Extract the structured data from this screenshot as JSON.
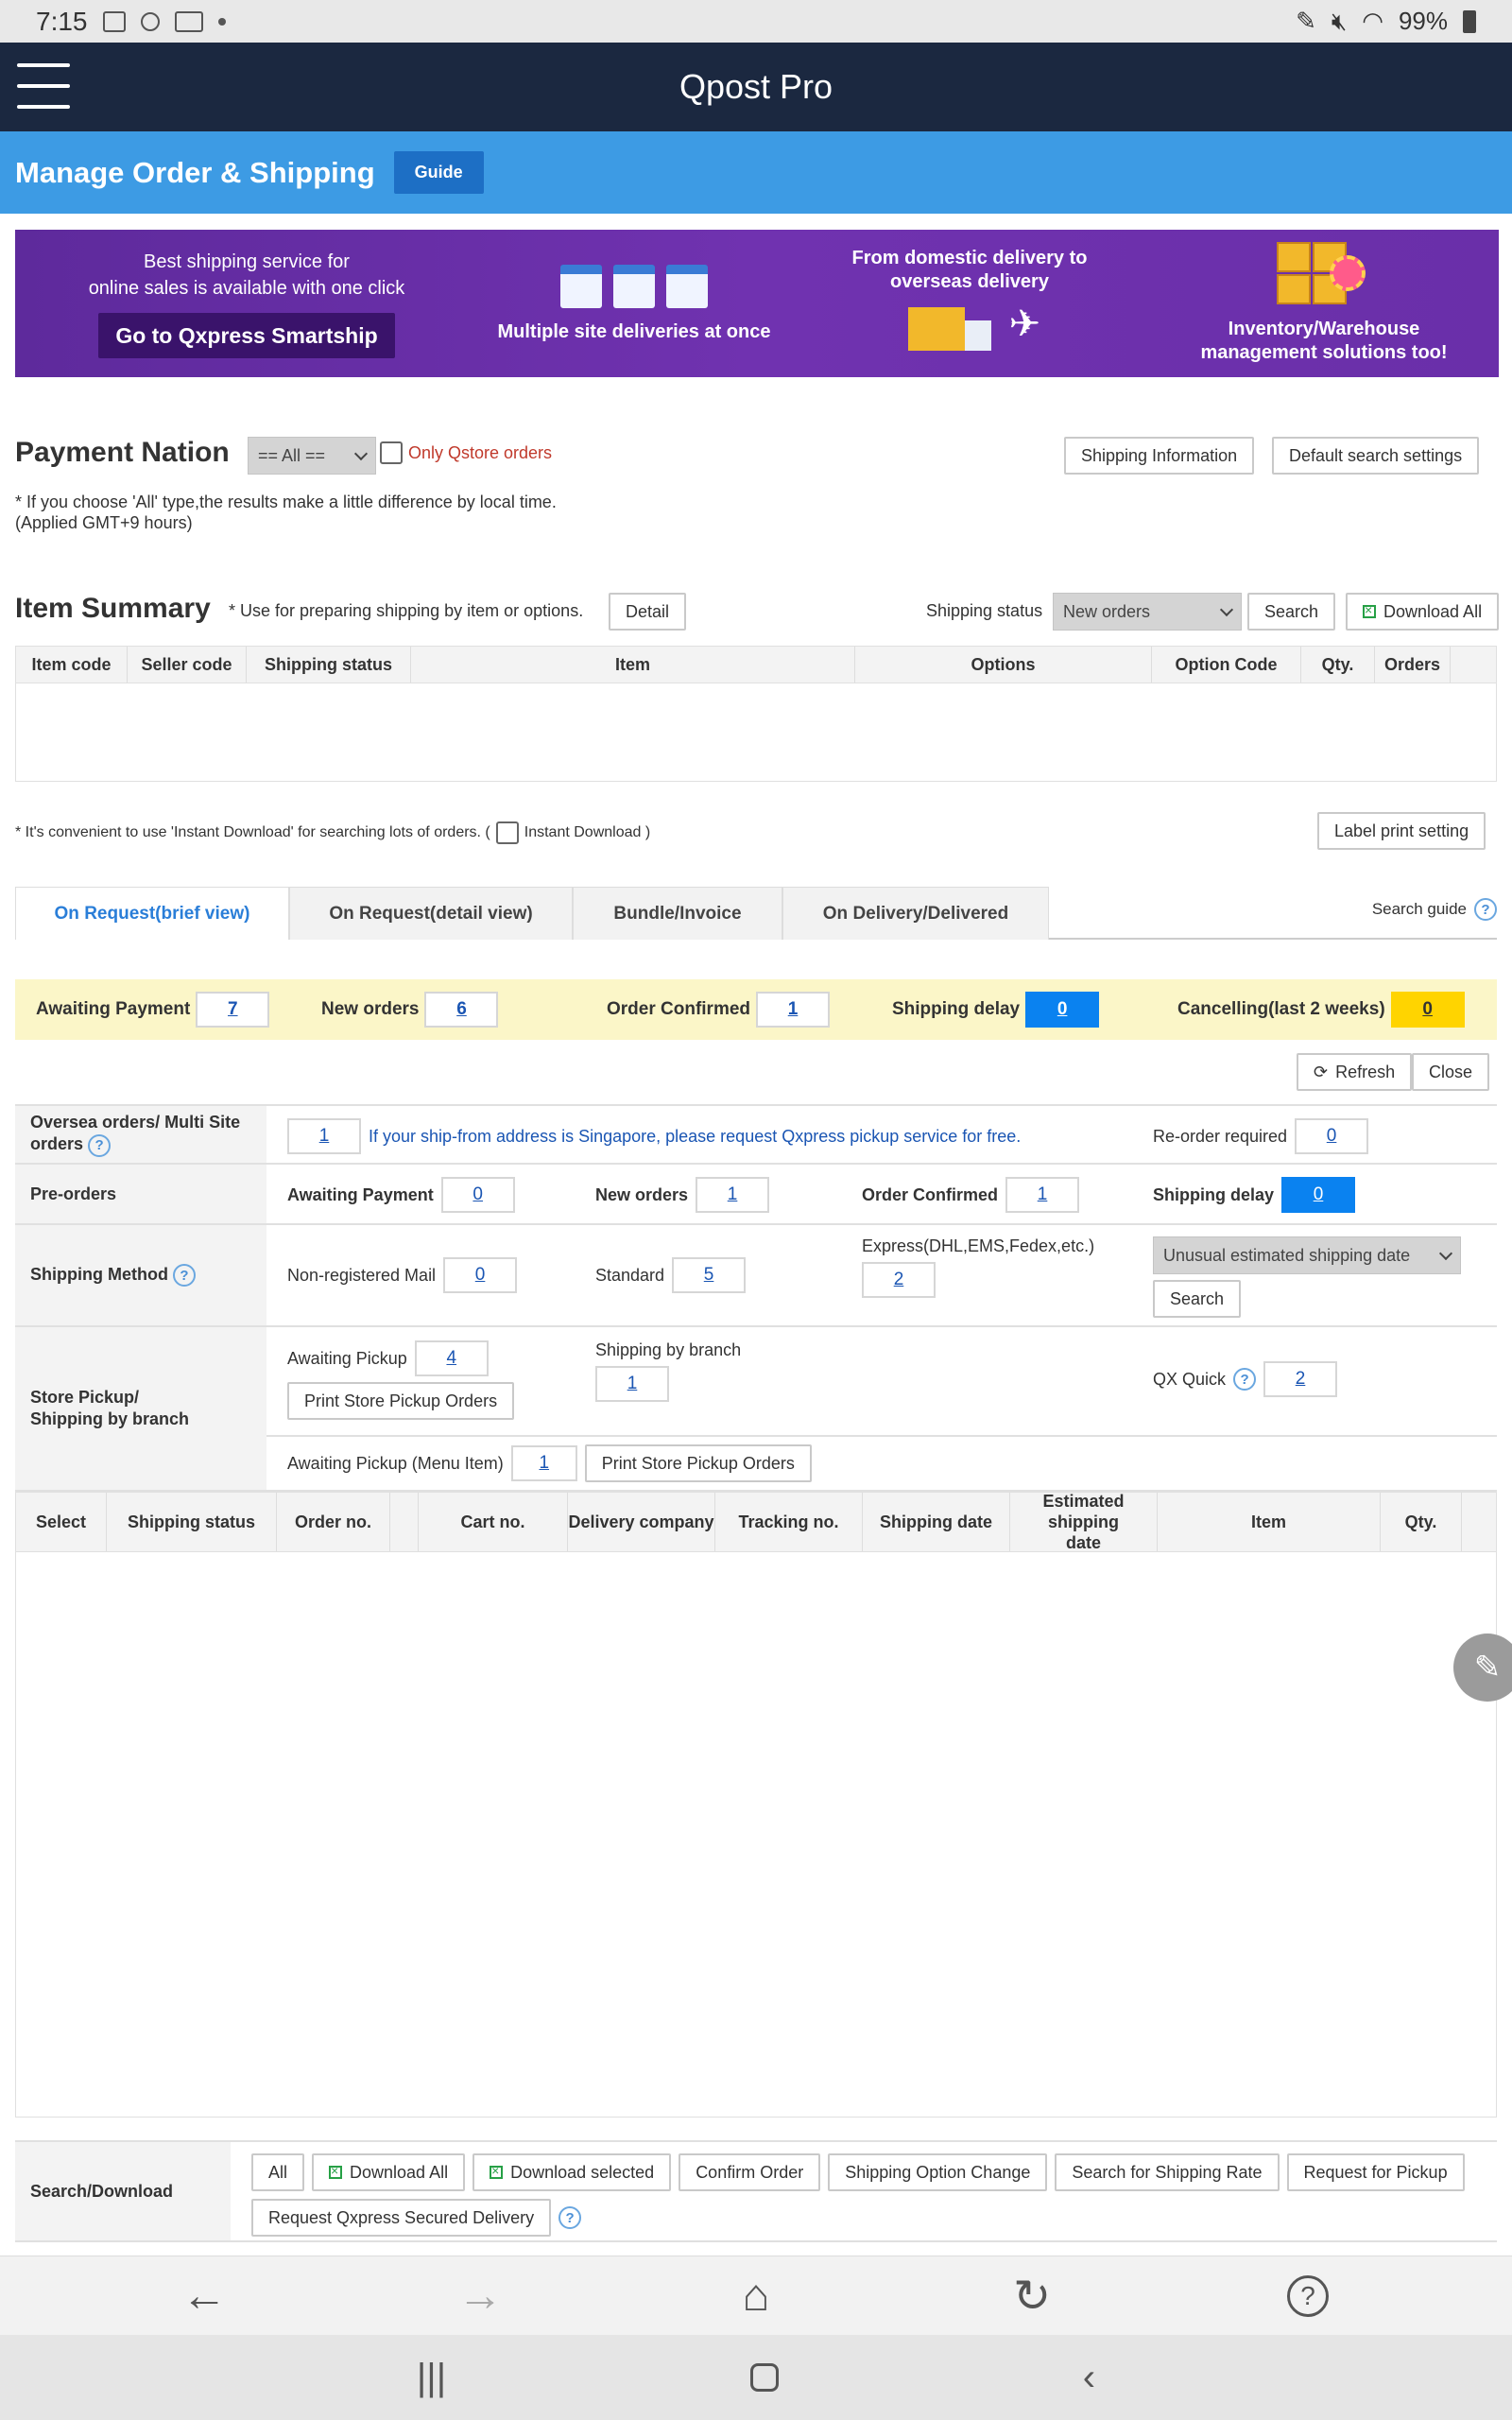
{
  "status_bar": {
    "time": "7:15",
    "battery": "99%"
  },
  "app": {
    "title": "Qpost Pro"
  },
  "page": {
    "title": "Manage Order & Shipping",
    "guide": "Guide"
  },
  "banner": {
    "line1": "Best shipping service for",
    "line2": "online sales is available with one click",
    "cta": "Go to Qxpress Smartship",
    "multi_site": "Multiple site deliveries at once",
    "domestic1": "From domestic delivery to",
    "domestic2": "overseas delivery",
    "inventory1": "Inventory/Warehouse",
    "inventory2": "management solutions too!"
  },
  "payment_nation": {
    "title": "Payment Nation",
    "select_value": "== All ==",
    "qstore_label": "Only Qstore orders",
    "shipping_info_btn": "Shipping Information",
    "default_search_btn": "Default search settings",
    "note1": "* If you choose 'All' type,the results make a little difference by local time.",
    "note2": "(Applied GMT+9 hours)"
  },
  "item_summary": {
    "title": "Item Summary",
    "note": "* Use for preparing shipping by item or options.",
    "detail_btn": "Detail",
    "status_label": "Shipping status",
    "status_value": "New orders",
    "search_btn": "Search",
    "download_all_btn": "Download All",
    "columns": [
      "Item code",
      "Seller code",
      "Shipping status",
      "Item",
      "Options",
      "Option Code",
      "Qty.",
      "Orders"
    ]
  },
  "instant": {
    "note_pre": "* It's convenient to use 'Instant Download' for searching lots of orders. (",
    "note_label": "Instant Download )",
    "label_print_btn": "Label print setting"
  },
  "tabs": [
    "On Request(brief view)",
    "On Request(detail view)",
    "Bundle/Invoice",
    "On Delivery/Delivered"
  ],
  "search_guide": "Search guide",
  "strip": {
    "awaiting_payment": {
      "label": "Awaiting Payment",
      "value": "7"
    },
    "new_orders": {
      "label": "New orders",
      "value": "6"
    },
    "order_confirmed": {
      "label": "Order Confirmed",
      "value": "1"
    },
    "shipping_delay": {
      "label": "Shipping delay",
      "value": "0"
    },
    "cancelling": {
      "label": "Cancelling(last 2 weeks)",
      "value": "0"
    }
  },
  "actions": {
    "refresh": "Refresh",
    "close": "Close"
  },
  "grid": {
    "oversea": {
      "label": "Oversea orders/ Multi Site orders",
      "value": "1",
      "note": "If your ship-from address is Singapore, please request Qxpress pickup service for free.",
      "reorder_label": "Re-order required",
      "reorder_value": "0"
    },
    "preorders": {
      "label": "Pre-orders",
      "awaiting_payment": "Awaiting Payment",
      "awaiting_payment_value": "0",
      "new_orders": "New orders",
      "new_orders_value": "1",
      "order_confirmed": "Order Confirmed",
      "order_confirmed_value": "1",
      "shipping_delay": "Shipping delay",
      "shipping_delay_value": "0"
    },
    "shipping_method": {
      "label": "Shipping Method",
      "nonreg": "Non-registered Mail",
      "nonreg_value": "0",
      "standard": "Standard",
      "standard_value": "5",
      "express": "Express(DHL,EMS,Fedex,etc.)",
      "express_value": "2",
      "unusual_select": "Unusual estimated shipping date",
      "search_btn": "Search"
    },
    "store_pickup": {
      "label1": "Store Pickup/",
      "label2": "Shipping by branch",
      "awaiting_pickup": "Awaiting Pickup",
      "awaiting_pickup_value": "4",
      "print_btn": "Print Store Pickup Orders",
      "by_branch": "Shipping by branch",
      "by_branch_value": "1",
      "qx_quick": "QX Quick",
      "qx_quick_value": "2",
      "menu_item": "Awaiting Pickup (Menu Item)",
      "menu_item_value": "1",
      "print_btn2": "Print Store Pickup Orders"
    }
  },
  "orders_table": {
    "columns": [
      "Select",
      "Shipping status",
      "Order no.",
      "",
      "Cart no.",
      "Delivery company",
      "Tracking no.",
      "Shipping date",
      "Estimated shipping date",
      "Item",
      "Qty."
    ]
  },
  "search_download": {
    "label": "Search/Download",
    "buttons": [
      "All",
      "Download All",
      "Download selected",
      "Confirm Order",
      "Shipping Option Change",
      "Search for Shipping Rate",
      "Request for Pickup",
      "Request Qxpress Secured Delivery"
    ]
  },
  "colors": {
    "header": "#1b2840",
    "page_head": "#3d9be4",
    "accent_blue": "#0a82f0",
    "accent_yellow": "#ffd400"
  }
}
